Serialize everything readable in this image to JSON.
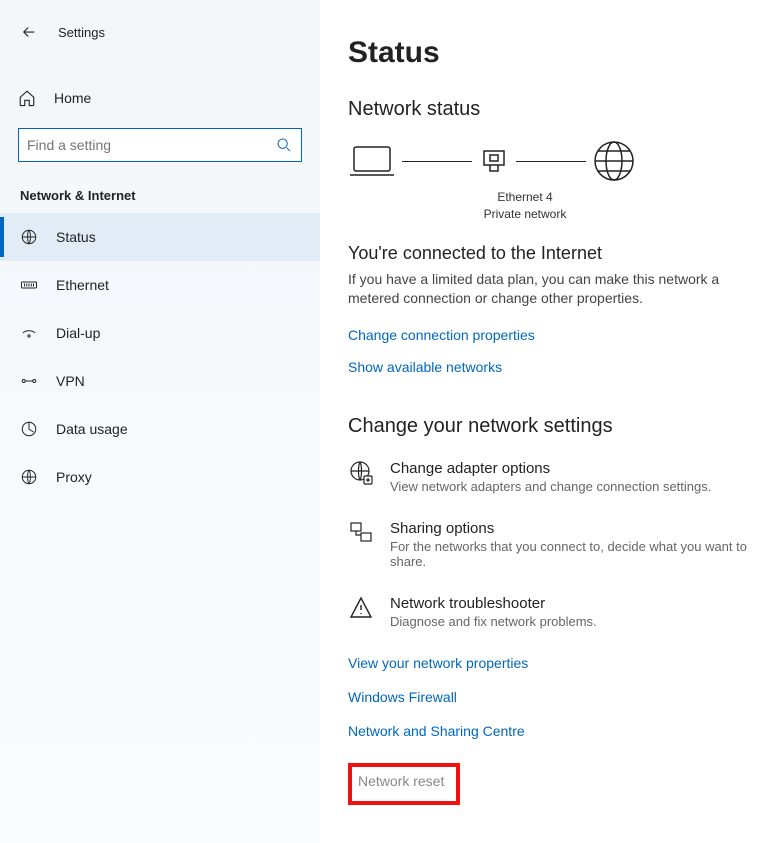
{
  "window": {
    "title": "Settings"
  },
  "sidebar": {
    "home_label": "Home",
    "search_placeholder": "Find a setting",
    "section_title": "Network & Internet",
    "items": [
      {
        "label": "Status"
      },
      {
        "label": "Ethernet"
      },
      {
        "label": "Dial-up"
      },
      {
        "label": "VPN"
      },
      {
        "label": "Data usage"
      },
      {
        "label": "Proxy"
      }
    ]
  },
  "main": {
    "page_title": "Status",
    "network_status_heading": "Network status",
    "diagram": {
      "connection_name": "Ethernet 4",
      "network_type": "Private network"
    },
    "connected_title": "You're connected to the Internet",
    "connected_desc": "If you have a limited data plan, you can make this network a metered connection or change other properties.",
    "link_change_props": "Change connection properties",
    "link_show_networks": "Show available networks",
    "change_settings_heading": "Change your network settings",
    "settings": [
      {
        "title": "Change adapter options",
        "desc": "View network adapters and change connection settings."
      },
      {
        "title": "Sharing options",
        "desc": "For the networks that you connect to, decide what you want to share."
      },
      {
        "title": "Network troubleshooter",
        "desc": "Diagnose and fix network problems."
      }
    ],
    "link_view_props": "View your network properties",
    "link_firewall": "Windows Firewall",
    "link_sharing_centre": "Network and Sharing Centre",
    "link_network_reset": "Network reset"
  }
}
